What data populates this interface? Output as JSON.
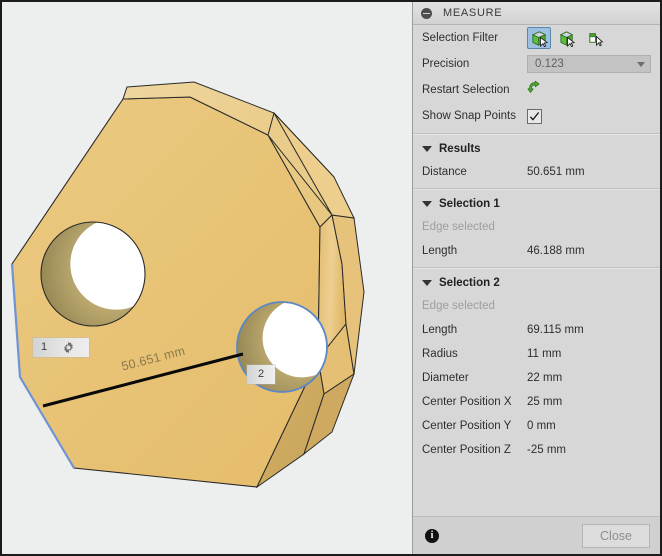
{
  "panel": {
    "title": "MEASURE",
    "collapse_icon": "collapse-dot-icon",
    "settings": {
      "selection_filter_label": "Selection Filter",
      "filters": [
        {
          "name": "filter-select-faces",
          "active": true
        },
        {
          "name": "filter-select-bodies",
          "active": false
        },
        {
          "name": "filter-select-sketches",
          "active": false
        }
      ],
      "precision_label": "Precision",
      "precision_value": "0.123",
      "restart_selection_label": "Restart Selection",
      "restart_icon": "restart-arrow-icon",
      "show_snap_points_label": "Show Snap Points",
      "show_snap_points_checked": true
    },
    "sections": [
      {
        "name": "results",
        "title": "Results",
        "rows": [
          {
            "label": "Distance",
            "value": "50.651 mm",
            "muted": false
          }
        ]
      },
      {
        "name": "selection-1",
        "title": "Selection 1",
        "rows": [
          {
            "label": "Edge selected",
            "value": "",
            "muted": true
          },
          {
            "label": "Length",
            "value": "46.188 mm",
            "muted": false
          }
        ]
      },
      {
        "name": "selection-2",
        "title": "Selection 2",
        "rows": [
          {
            "label": "Edge selected",
            "value": "",
            "muted": true
          },
          {
            "label": "Length",
            "value": "69.115 mm",
            "muted": false
          },
          {
            "label": "Radius",
            "value": "11 mm",
            "muted": false
          },
          {
            "label": "Diameter",
            "value": "22 mm",
            "muted": false
          },
          {
            "label": "Center Position X",
            "value": "25 mm",
            "muted": false
          },
          {
            "label": "Center Position Y",
            "value": "0 mm",
            "muted": false
          },
          {
            "label": "Center Position Z",
            "value": "-25 mm",
            "muted": false
          }
        ]
      }
    ],
    "footer": {
      "info_icon": "info-icon",
      "info_glyph": "i",
      "close_label": "Close"
    }
  },
  "viewport": {
    "background_color": "#edeeee",
    "body_color": "#e7c176",
    "highlight_edge_color": "#5b86c7",
    "measure_edge_color": "#111111",
    "dimension_text": "50.651 mm",
    "markers": [
      {
        "name": "selection-marker-1",
        "number": "1",
        "gear_icon": "gear-icon"
      },
      {
        "name": "selection-marker-2",
        "number": "2"
      }
    ]
  }
}
